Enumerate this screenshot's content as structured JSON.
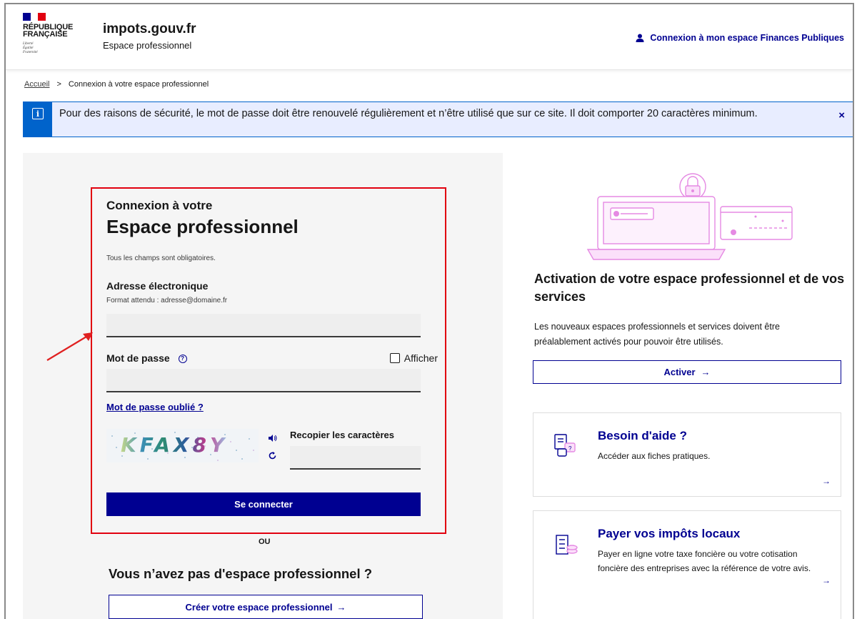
{
  "header": {
    "republic_name": "RÉPUBLIQUE\nFRANÇAISE",
    "republic_motto": "Liberté\nÉgalité\nFraternité",
    "site_title": "impots.gouv.fr",
    "site_subtitle": "Espace professionnel",
    "login_link": "Connexion à mon espace Finances Publiques"
  },
  "breadcrumb": {
    "home": "Accueil",
    "separator": ">",
    "current": "Connexion à votre espace professionnel"
  },
  "notice": {
    "icon": "i",
    "text": "Pour des raisons de sécurité, le mot de passe doit être renouvelé régulièrement et n’être utilisé que sur ce site. Il doit comporter 20 caractères minimum.",
    "close": "×"
  },
  "login": {
    "pretitle": "Connexion à votre",
    "title": "Espace professionnel",
    "required_note": "Tous les champs sont obligatoires.",
    "email_label": "Adresse électronique",
    "email_hint": "Format attendu : adresse@domaine.fr",
    "email_value": "",
    "password_label": "Mot de passe",
    "password_help": "?",
    "show_password_label": "Afficher",
    "forgot_password": "Mot de passe oublié ?",
    "captcha_text": "KFAX8Y",
    "captcha_audio_icon": "speaker-icon",
    "captcha_refresh_icon": "refresh-icon",
    "captcha_label": "Recopier les caractères",
    "captcha_value": "",
    "submit": "Se connecter"
  },
  "alternative": {
    "or": "OU",
    "no_space_title": "Vous n’avez pas d'espace professionnel ?",
    "create_button": "Créer votre espace professionnel",
    "create_arrow": "→"
  },
  "activation": {
    "title": "Activation de votre espace professionnel et de vos services",
    "description": "Les nouveaux espaces professionnels et services doivent être préalablement activés pour pouvoir être utilisés.",
    "button": "Activer",
    "button_arrow": "→"
  },
  "cards": [
    {
      "title": "Besoin d'aide ?",
      "description": "Accéder aux fiches pratiques.",
      "arrow": "→"
    },
    {
      "title": "Payer vos impôts locaux",
      "description": "Payer en ligne votre taxe foncière ou votre cotisation foncière des entreprises avec la référence de votre avis.",
      "arrow": "→"
    }
  ],
  "colors": {
    "primary": "#000091",
    "info": "#0063cb",
    "highlight": "#e1000f",
    "illustration": "#e58ae3"
  }
}
